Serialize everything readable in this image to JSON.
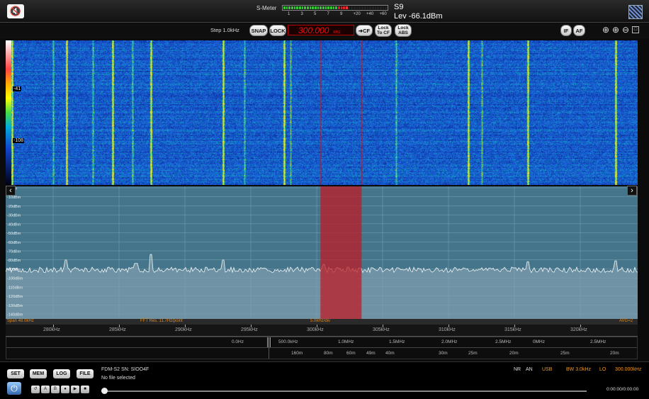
{
  "top": {
    "smeter_label": "S-Meter",
    "smeter_ticks": [
      "1",
      "3",
      "5",
      "7",
      "9",
      "+20",
      "+40",
      "+60"
    ],
    "s_reading": "S9",
    "level": "Lev -66.1dBm",
    "smeter_level_fraction": 0.6
  },
  "toolbar": {
    "step": "Step 1.0kHz",
    "snap": "SNAP",
    "lock": "LOCK",
    "frequency": "300.000",
    "frequency_unit": "kHz",
    "to_cf": "CF",
    "lock_to_cf_l1": "Lock",
    "lock_to_cf_l2": "To CF",
    "lock_abs_l1": "Lock",
    "lock_abs_l2": "ABS",
    "if": "IF",
    "af": "AF"
  },
  "waterfall": {
    "colorbar_high": "-41",
    "colorbar_low": "-108",
    "strong_lines_khz": [
      276.9,
      281.0,
      284.5,
      287.4,
      292.9,
      297.5,
      311.5,
      316.0,
      322.7
    ],
    "weak_lines_khz": [
      276.0,
      280.0,
      283.0,
      286.0,
      294.5,
      298.0,
      306.0,
      312.5,
      326.6
    ]
  },
  "spectrum": {
    "db_labels": [
      "0dBm",
      "-10dBm",
      "-20dBm",
      "-30dBm",
      "-40dBm",
      "-50dBm",
      "-60dBm",
      "-70dBm",
      "-80dBm",
      "-90dBm",
      "-100dBm",
      "-110dBm",
      "-120dBm",
      "-130dBm",
      "-140dBm"
    ],
    "noise_floor_dbm": -91,
    "filter_bandwidth_khz": 3.0,
    "peaks": [
      {
        "khz": 281.0,
        "dbm": -80
      },
      {
        "khz": 286.3,
        "dbm": -84
      },
      {
        "khz": 287.4,
        "dbm": -74
      },
      {
        "khz": 292.9,
        "dbm": -80
      },
      {
        "khz": 300.5,
        "dbm": -85
      },
      {
        "khz": 316.0,
        "dbm": -82
      },
      {
        "khz": 322.7,
        "dbm": -81
      }
    ]
  },
  "info": {
    "span": "Span 48.0kHz",
    "fft": "FFT Res. 11.7Hz/point",
    "div": "5.0kHz/div",
    "avg": "AVG=2"
  },
  "ruler": {
    "ticks": [
      "280kHz",
      "285kHz",
      "290kHz",
      "295kHz",
      "300kHz",
      "305kHz",
      "310kHz",
      "315kHz",
      "320kHz"
    ]
  },
  "band": {
    "row1": [
      "0.0Hz",
      "500.0kHz",
      "1.0MHz",
      "1.5MHz",
      "2.0MHz",
      "2.5MHz",
      "0MHz",
      "2.5MHz"
    ],
    "row2": [
      "160m",
      "80m",
      "60m",
      "49m",
      "40m",
      "30m",
      "25m",
      "20m",
      "25m",
      "20m"
    ]
  },
  "status": {
    "btn_set": "SET",
    "btn_mem": "MEM",
    "btn_log": "LOG",
    "btn_file": "FILE",
    "device": "FDM-S2 SN: SIOO4F",
    "file": "No file selected",
    "nr": "NR",
    "an": "AN",
    "mode": "USB",
    "bw": "BW 3.0kHz",
    "lo_label": "LO",
    "lo_value": "300.000kHz",
    "time": "0:00:00/0:00:00",
    "tape_a": "A",
    "tape_b": "B"
  },
  "colors": {
    "waterfall_bg": "#1848b8",
    "spectrum_bg": "#44758a",
    "filter": "#c01820",
    "accent": "#f39a1c"
  }
}
